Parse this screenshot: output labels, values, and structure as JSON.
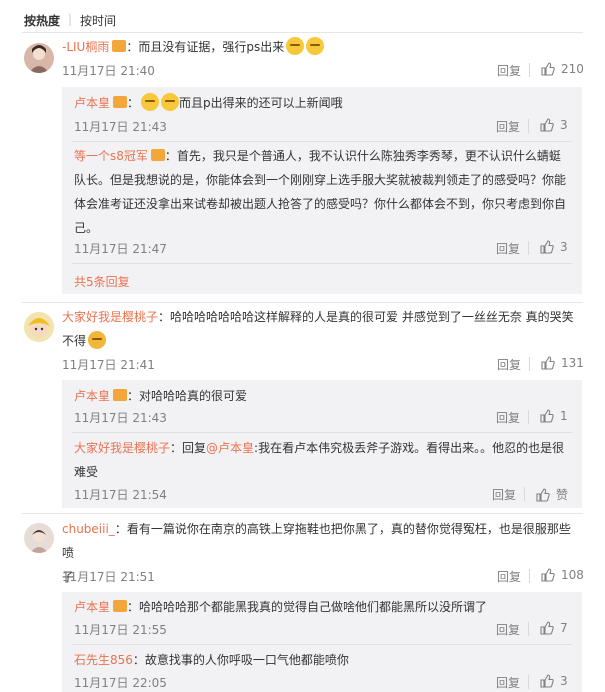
{
  "sort": {
    "hot": "按热度",
    "time": "按时间"
  },
  "actions": {
    "reply": "回复"
  },
  "comments": [
    {
      "user": "-LIU桐雨",
      "text": "：而且没有证据，强行ps出来",
      "time": "11月17日 21:40",
      "likes": "210",
      "replies": [
        {
          "user": "卢本皇",
          "text": "而且p出得来的还可以上新闻哦",
          "time": "11月17日 21:43",
          "likes": "3"
        },
        {
          "user": "等一个s8冠军",
          "text_lines": [
            "：首先，我只是个普通人，我不认识什么陈独秀李秀琴，更不认识什么蜻蜓",
            "队长。但是我想说的是，你能体会到一个刚刚穿上选手服大奖就被裁判领走了的感受吗？你能",
            "体会准考证还没拿出来试卷却被出题人抢答了的感受吗？你什么都体会不到，你只考虑到你自",
            "己。"
          ],
          "time": "11月17日 21:47",
          "likes": "3"
        }
      ],
      "more": "共5条回复"
    },
    {
      "user": "大家好我是樱桃子",
      "text_lines": [
        "：哈哈哈哈哈哈哈这样解释的人是真的很可爱 并感觉到了一丝丝无奈 真的哭笑",
        "不得"
      ],
      "time": "11月17日 21:41",
      "likes": "131",
      "replies": [
        {
          "user": "卢本皇",
          "text": "：对哈哈哈真的很可爱",
          "time": "11月17日 21:43",
          "likes": "1"
        },
        {
          "user": "大家好我是樱桃子",
          "text_prefix": "：回复",
          "at": "@卢本皇",
          "text_lines": [
            ":我在看卢本伟究极丢斧子游戏。看得出来。。他忍的也是很",
            "难受"
          ],
          "time": "11月17日 21:54",
          "likes": "赞"
        }
      ]
    },
    {
      "user": "chubeiii_",
      "text_lines": [
        "：看有一篇说你在南京的高铁上穿拖鞋也把你黑了，真的替你觉得冤枉，也是很服那些喷",
        "子"
      ],
      "time": "11月17日 21:51",
      "likes": "108",
      "replies": [
        {
          "user": "卢本皇",
          "text": "：哈哈哈哈那个都能黑我真的觉得自己做啥他们都能黑所以没所谓了",
          "time": "11月17日 21:55",
          "likes": "7"
        },
        {
          "user": "石先生856",
          "text": "：故意找事的人你呼吸一口气他都能喷你",
          "time": "11月17日 22:05",
          "likes": "3"
        }
      ]
    }
  ]
}
